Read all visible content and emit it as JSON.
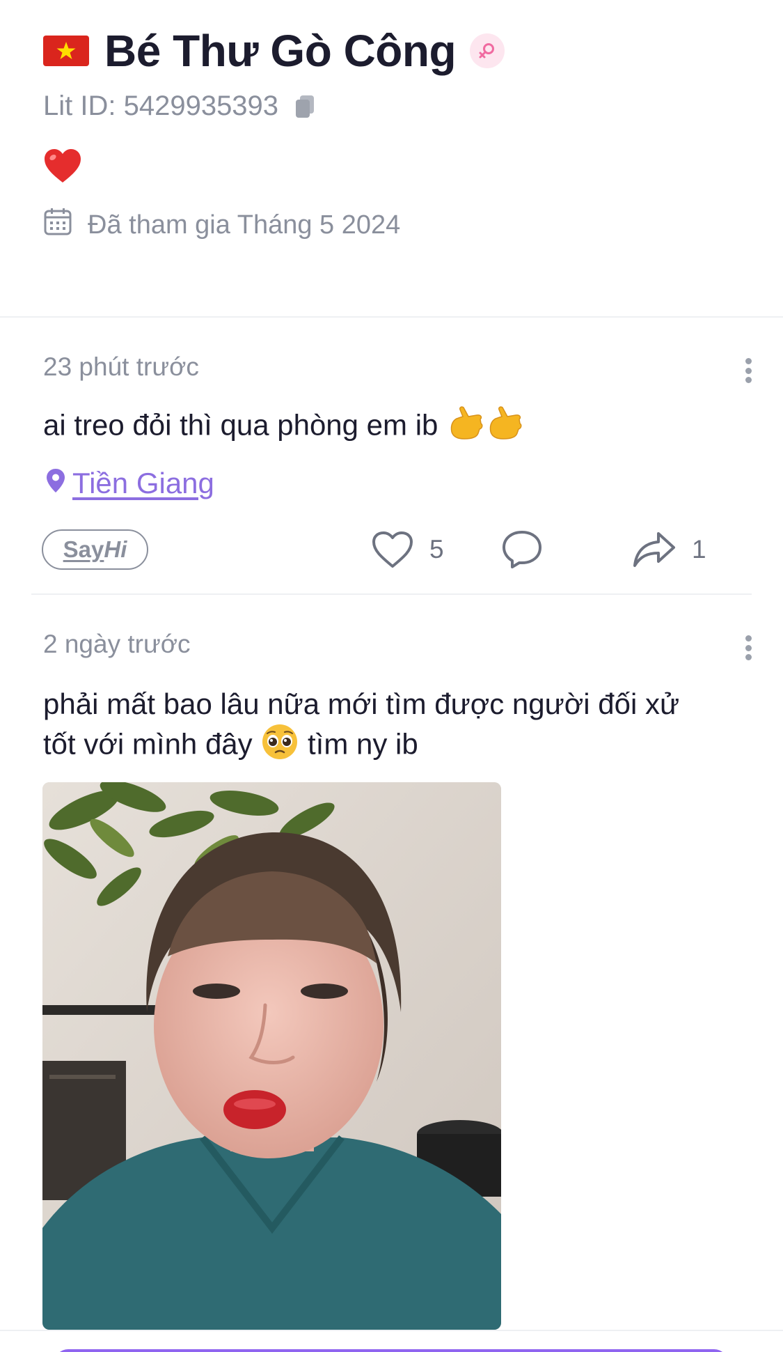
{
  "profile": {
    "flag_icon": "vietnam-flag-icon",
    "name": "Bé Thư Gò Công",
    "gender_icon": "female-symbol-icon",
    "lit_id": "Lit ID: 5429935393",
    "bio_emoji": "red-heart-emoji",
    "joined": "Đã tham gia Tháng 5 2024"
  },
  "posts": [
    {
      "time": "23 phút trước",
      "text": "ai treo đỏi thì qua phòng em ib",
      "text_emojis": [
        "call-me-hand-emoji",
        "call-me-hand-emoji"
      ],
      "location": "Tiền Giang",
      "say_hi": {
        "say": "Say",
        "hi": "Hi"
      },
      "likes": "5",
      "shares": "1"
    },
    {
      "time": "2 ngày trước",
      "text_line1": "phải mất bao lâu nữa mới tìm được người đối xử",
      "text_line2_a": "tốt với mình đây",
      "text_emoji": "pleading-face-emoji",
      "text_line2_b": "tìm ny ib",
      "photo": "selfie-photo"
    }
  ],
  "colors": {
    "accent": "#8c6ee0",
    "text_primary": "#1c1c2e",
    "text_muted": "#8a8f9c",
    "divider": "#eef0f3",
    "button": "#8f65f0"
  }
}
